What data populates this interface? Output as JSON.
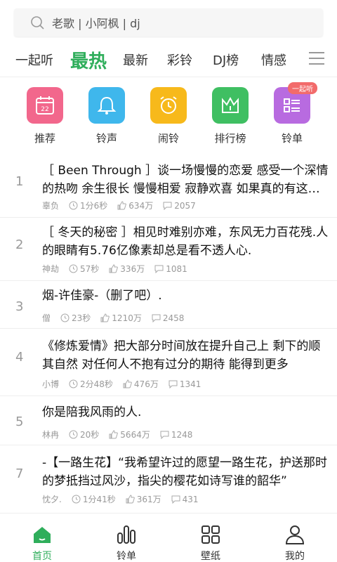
{
  "search": {
    "placeholder": "老歌 | 小阿枫 | dj"
  },
  "tabs": [
    {
      "label": "一起听"
    },
    {
      "label": "最热",
      "active": true
    },
    {
      "label": "最新"
    },
    {
      "label": "彩铃"
    },
    {
      "label": "DJ榜"
    },
    {
      "label": "情感"
    }
  ],
  "categories": [
    {
      "label": "推荐",
      "icon": "calendar-icon",
      "color": "#f2678c"
    },
    {
      "label": "铃声",
      "icon": "bell-icon",
      "color": "#3fb7ec"
    },
    {
      "label": "闹铃",
      "icon": "alarm-clock-icon",
      "color": "#f7b91b"
    },
    {
      "label": "排行榜",
      "icon": "crown-icon",
      "color": "#3fbf62"
    },
    {
      "label": "铃单",
      "icon": "list-icon",
      "color": "#b86be0",
      "badge": "一起听"
    }
  ],
  "songs": [
    {
      "num": "1",
      "title": "［ Been Through ］谈一场慢慢的恋爱 感受一个深情的热吻 余生很长 慢慢相爱 寂静欢喜 如果真的有这么一个人",
      "author": "辜负",
      "duration": "1分6秒",
      "likes": "634万",
      "comments": "2057"
    },
    {
      "num": "2",
      "title": "［ 冬天的秘密 ］相见时难别亦难，东风无力百花残.人的眼睛有5.76亿像素却总是看不透人心.",
      "author": "神劫",
      "duration": "57秒",
      "likes": "336万",
      "comments": "1081"
    },
    {
      "num": "3",
      "title": "烟-许佳豪-（删了吧）.",
      "author": "僧",
      "duration": "23秒",
      "likes": "1210万",
      "comments": "2458"
    },
    {
      "num": "4",
      "title": "《修炼爱情》把大部分时间放在提升自己上 剩下的顺其自然 对任何人不抱有过分的期待 能得到更多",
      "author": "小博",
      "duration": "2分48秒",
      "likes": "476万",
      "comments": "1341"
    },
    {
      "num": "5",
      "title": "你是陪我风雨的人.",
      "author": "林冉",
      "duration": "20秒",
      "likes": "5664万",
      "comments": "1248"
    },
    {
      "num": "7",
      "title": "-【一路生花】“我希望许过的愿望一路生花，护送那时的梦抵挡过风沙，指尖的樱花如诗写谁的韶华”",
      "author": "忱夕.",
      "duration": "1分41秒",
      "likes": "361万",
      "comments": "431"
    }
  ],
  "bottom_nav": [
    {
      "label": "首页",
      "icon": "home-icon",
      "active": true
    },
    {
      "label": "铃单",
      "icon": "bars-icon"
    },
    {
      "label": "壁纸",
      "icon": "grid-icon"
    },
    {
      "label": "我的",
      "icon": "person-icon"
    }
  ],
  "colors": {
    "accent": "#2fae5b"
  }
}
